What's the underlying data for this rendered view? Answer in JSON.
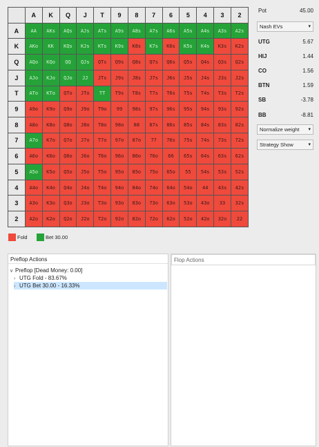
{
  "grid": {
    "headers": [
      "A",
      "K",
      "Q",
      "J",
      "T",
      "9",
      "8",
      "7",
      "6",
      "5",
      "4",
      "3",
      "2"
    ],
    "rows": [
      [
        [
          "AA",
          "b"
        ],
        [
          "AKs",
          "b"
        ],
        [
          "AQs",
          "b"
        ],
        [
          "AJs",
          "b"
        ],
        [
          "ATs",
          "b"
        ],
        [
          "A9s",
          "b"
        ],
        [
          "A8s",
          "b"
        ],
        [
          "A7s",
          "b"
        ],
        [
          "A6s",
          "b"
        ],
        [
          "A5s",
          "b"
        ],
        [
          "A4s",
          "b"
        ],
        [
          "A3s",
          "b"
        ],
        [
          "A2s",
          "b"
        ]
      ],
      [
        [
          "AKo",
          "b"
        ],
        [
          "KK",
          "b"
        ],
        [
          "KQs",
          "b"
        ],
        [
          "KJs",
          "b"
        ],
        [
          "KTs",
          "b"
        ],
        [
          "K9s",
          "b"
        ],
        [
          "K8s",
          "f"
        ],
        [
          "K7s",
          "b"
        ],
        [
          "K6s",
          "f"
        ],
        [
          "K5s",
          "b"
        ],
        [
          "K4s",
          "b"
        ],
        [
          "K3s",
          "f"
        ],
        [
          "K2s",
          "f"
        ]
      ],
      [
        [
          "AQo",
          "b"
        ],
        [
          "KQo",
          "b"
        ],
        [
          "QQ",
          "b"
        ],
        [
          "QJs",
          "b"
        ],
        [
          "QTs",
          "f"
        ],
        [
          "Q9s",
          "f"
        ],
        [
          "Q8s",
          "f"
        ],
        [
          "Q7s",
          "f"
        ],
        [
          "Q6s",
          "f"
        ],
        [
          "Q5s",
          "f"
        ],
        [
          "Q4s",
          "f"
        ],
        [
          "Q3s",
          "f"
        ],
        [
          "Q2s",
          "f"
        ]
      ],
      [
        [
          "AJo",
          "b"
        ],
        [
          "KJo",
          "b"
        ],
        [
          "QJo",
          "b"
        ],
        [
          "JJ",
          "b"
        ],
        [
          "JTs",
          "f"
        ],
        [
          "J9s",
          "f"
        ],
        [
          "J8s",
          "f"
        ],
        [
          "J7s",
          "f"
        ],
        [
          "J6s",
          "f"
        ],
        [
          "J5s",
          "f"
        ],
        [
          "J4s",
          "f"
        ],
        [
          "J3s",
          "f"
        ],
        [
          "J2s",
          "f"
        ]
      ],
      [
        [
          "ATo",
          "b"
        ],
        [
          "KTo",
          "b"
        ],
        [
          "QTo",
          "f"
        ],
        [
          "JTo",
          "f"
        ],
        [
          "TT",
          "b"
        ],
        [
          "T9s",
          "f"
        ],
        [
          "T8s",
          "f"
        ],
        [
          "T7s",
          "f"
        ],
        [
          "T6s",
          "f"
        ],
        [
          "T5s",
          "f"
        ],
        [
          "T4s",
          "f"
        ],
        [
          "T3s",
          "f"
        ],
        [
          "T2s",
          "f"
        ]
      ],
      [
        [
          "A9o",
          "f"
        ],
        [
          "K9o",
          "f"
        ],
        [
          "Q9o",
          "f"
        ],
        [
          "J9o",
          "f"
        ],
        [
          "T9o",
          "f"
        ],
        [
          "99",
          "f"
        ],
        [
          "98s",
          "f"
        ],
        [
          "97s",
          "f"
        ],
        [
          "96s",
          "f"
        ],
        [
          "95s",
          "f"
        ],
        [
          "94s",
          "f"
        ],
        [
          "93s",
          "f"
        ],
        [
          "92s",
          "f"
        ]
      ],
      [
        [
          "A8o",
          "f"
        ],
        [
          "K8o",
          "f"
        ],
        [
          "Q8o",
          "f"
        ],
        [
          "J8o",
          "f"
        ],
        [
          "T8o",
          "f"
        ],
        [
          "98o",
          "f"
        ],
        [
          "88",
          "f"
        ],
        [
          "87s",
          "f"
        ],
        [
          "86s",
          "f"
        ],
        [
          "85s",
          "f"
        ],
        [
          "84s",
          "f"
        ],
        [
          "83s",
          "f"
        ],
        [
          "82s",
          "f"
        ]
      ],
      [
        [
          "A7o",
          "b"
        ],
        [
          "K7o",
          "f"
        ],
        [
          "Q7o",
          "f"
        ],
        [
          "J7o",
          "f"
        ],
        [
          "T7o",
          "f"
        ],
        [
          "97o",
          "f"
        ],
        [
          "87o",
          "f"
        ],
        [
          "77",
          "f"
        ],
        [
          "76s",
          "f"
        ],
        [
          "75s",
          "f"
        ],
        [
          "74s",
          "f"
        ],
        [
          "73s",
          "f"
        ],
        [
          "72s",
          "f"
        ]
      ],
      [
        [
          "A6o",
          "f"
        ],
        [
          "K6o",
          "f"
        ],
        [
          "Q6o",
          "f"
        ],
        [
          "J6o",
          "f"
        ],
        [
          "T6o",
          "f"
        ],
        [
          "96o",
          "f"
        ],
        [
          "86o",
          "f"
        ],
        [
          "76o",
          "f"
        ],
        [
          "66",
          "f"
        ],
        [
          "65s",
          "f"
        ],
        [
          "64s",
          "f"
        ],
        [
          "63s",
          "f"
        ],
        [
          "62s",
          "f"
        ]
      ],
      [
        [
          "A5o",
          "b"
        ],
        [
          "K5o",
          "f"
        ],
        [
          "Q5o",
          "f"
        ],
        [
          "J5o",
          "f"
        ],
        [
          "T5o",
          "f"
        ],
        [
          "95o",
          "f"
        ],
        [
          "85o",
          "f"
        ],
        [
          "75o",
          "f"
        ],
        [
          "65o",
          "f"
        ],
        [
          "55",
          "f"
        ],
        [
          "54s",
          "f"
        ],
        [
          "53s",
          "f"
        ],
        [
          "52s",
          "f"
        ]
      ],
      [
        [
          "A4o",
          "f"
        ],
        [
          "K4o",
          "f"
        ],
        [
          "Q4o",
          "f"
        ],
        [
          "J4o",
          "f"
        ],
        [
          "T4o",
          "f"
        ],
        [
          "94o",
          "f"
        ],
        [
          "84o",
          "f"
        ],
        [
          "74o",
          "f"
        ],
        [
          "64o",
          "f"
        ],
        [
          "54o",
          "f"
        ],
        [
          "44",
          "f"
        ],
        [
          "43s",
          "f"
        ],
        [
          "42s",
          "f"
        ]
      ],
      [
        [
          "A3o",
          "f"
        ],
        [
          "K3o",
          "f"
        ],
        [
          "Q3o",
          "f"
        ],
        [
          "J3o",
          "f"
        ],
        [
          "T3o",
          "f"
        ],
        [
          "93o",
          "f"
        ],
        [
          "83o",
          "f"
        ],
        [
          "73o",
          "f"
        ],
        [
          "63o",
          "f"
        ],
        [
          "53o",
          "f"
        ],
        [
          "43o",
          "f"
        ],
        [
          "33",
          "f"
        ],
        [
          "32s",
          "f"
        ]
      ],
      [
        [
          "A2o",
          "f"
        ],
        [
          "K2o",
          "f"
        ],
        [
          "Q2o",
          "f"
        ],
        [
          "J2o",
          "f"
        ],
        [
          "T2o",
          "f"
        ],
        [
          "92o",
          "f"
        ],
        [
          "82o",
          "f"
        ],
        [
          "72o",
          "f"
        ],
        [
          "62o",
          "f"
        ],
        [
          "52o",
          "f"
        ],
        [
          "42o",
          "f"
        ],
        [
          "32o",
          "f"
        ],
        [
          "22",
          "f"
        ]
      ]
    ]
  },
  "side": {
    "pot_label": "Pot",
    "pot_value": "45.00",
    "ev_dropdown": "Nash EVs",
    "positions": [
      {
        "name": "UTG",
        "ev": "5.67"
      },
      {
        "name": "HIJ",
        "ev": "1.44"
      },
      {
        "name": "CO",
        "ev": "1.56"
      },
      {
        "name": "BTN",
        "ev": "1.59"
      },
      {
        "name": "SB",
        "ev": "-3.78"
      },
      {
        "name": "BB",
        "ev": "-8.81"
      }
    ],
    "normalize_dropdown": "Normalize weight",
    "strategy_dropdown": "Strategy Show"
  },
  "legend": {
    "fold_label": "Fold",
    "bet_label": "Bet 30.00",
    "fold_color": "#ef4a3c",
    "bet_color": "#25a338"
  },
  "preflop": {
    "title": "Preflop Actions",
    "root": "Preflop [Dead Money: 0.00]",
    "items": [
      "UTG Fold - 83.67%",
      "UTG Bet 30.00 - 16.33%"
    ]
  },
  "flop": {
    "title": "Flop Actions"
  }
}
